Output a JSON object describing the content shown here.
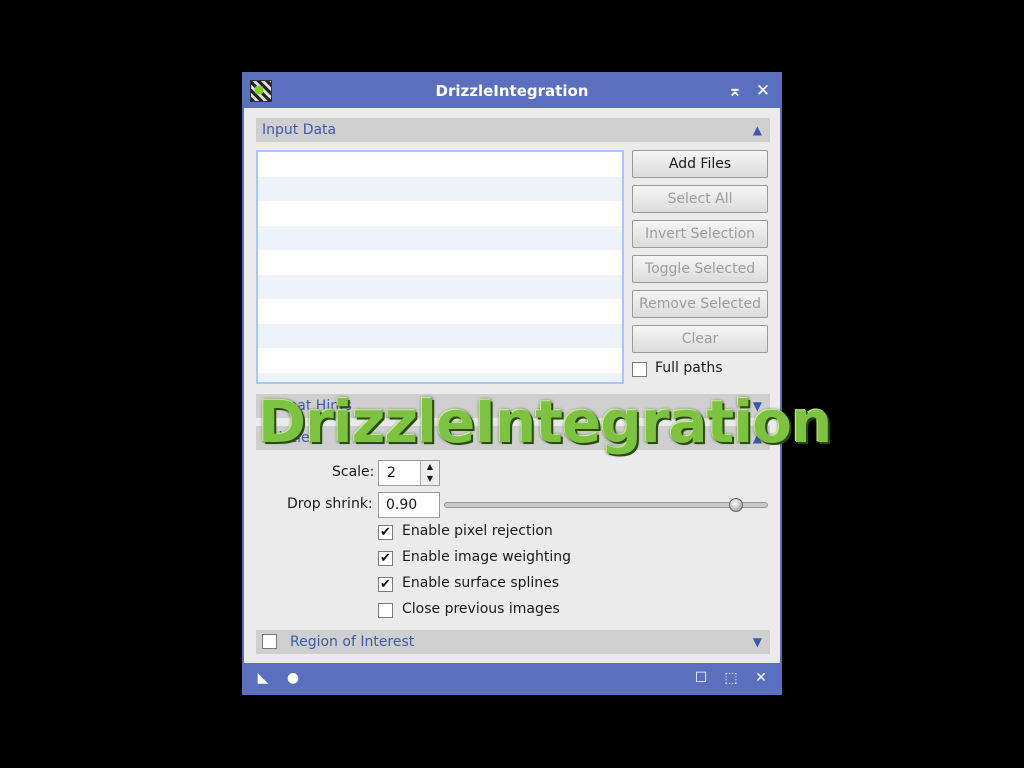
{
  "window": {
    "title": "DrizzleIntegration",
    "minimize_icon": "⌅",
    "close_icon": "✕"
  },
  "sections": {
    "input_data": "Input Data",
    "format_hints": "Format Hints",
    "drizzle": "Drizzle",
    "region_of_interest": "Region of Interest"
  },
  "buttons": {
    "add_files": "Add Files",
    "select_all": "Select All",
    "invert_selection": "Invert Selection",
    "toggle_selected": "Toggle Selected",
    "remove_selected": "Remove Selected",
    "clear": "Clear"
  },
  "full_paths": {
    "label": "Full paths",
    "checked": false
  },
  "drizzle": {
    "scale_label": "Scale:",
    "scale_value": "2",
    "drop_shrink_label": "Drop shrink:",
    "drop_shrink_value": "0.90",
    "drop_shrink_fraction": 0.9,
    "options": [
      {
        "label": "Enable pixel rejection",
        "checked": true
      },
      {
        "label": "Enable image weighting",
        "checked": true
      },
      {
        "label": "Enable surface splines",
        "checked": true
      },
      {
        "label": "Close previous images",
        "checked": false
      }
    ]
  },
  "region_of_interest_checked": false,
  "overlay": {
    "text": "DrizzleIntegration"
  },
  "colors": {
    "titlebar": "#5b6fbf",
    "section_text": "#3b5aa8",
    "overlay_text": "#7dc341"
  }
}
